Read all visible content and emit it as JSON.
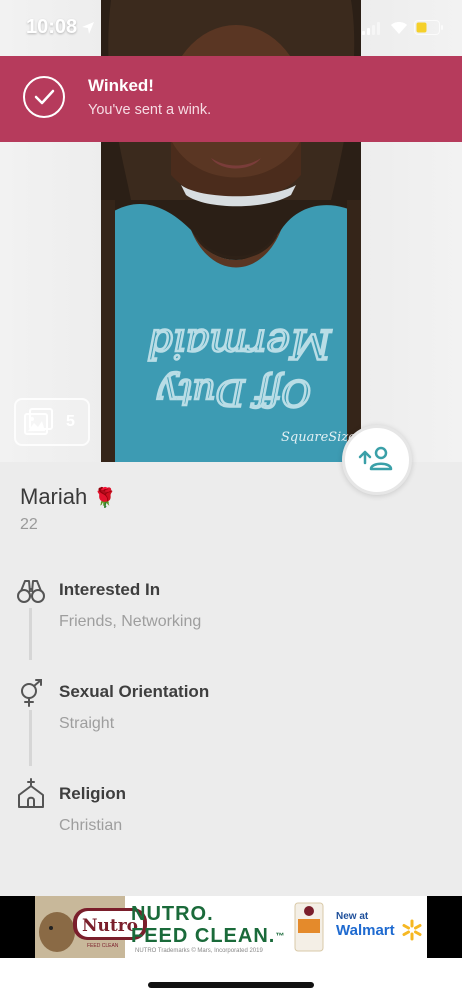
{
  "status_bar": {
    "time": "10:08"
  },
  "toast": {
    "title": "Winked!",
    "subtitle": "You've sent a wink."
  },
  "photo": {
    "count": "5",
    "watermark": "SquareSized"
  },
  "profile": {
    "name": "Mariah",
    "name_emoji": "🌹",
    "age": "22",
    "details": [
      {
        "icon": "binoculars-icon",
        "title": "Interested In",
        "value": "Friends, Networking"
      },
      {
        "icon": "gender-symbol-icon",
        "title": "Sexual Orientation",
        "value": "Straight"
      },
      {
        "icon": "church-icon",
        "title": "Religion",
        "value": "Christian"
      }
    ]
  },
  "ad": {
    "logo": "Nutro",
    "logo_sub": "FEED CLEAN",
    "headline_1": "NUTRO.",
    "headline_2": "FEED CLEAN.",
    "tm": "™",
    "new_at": "New at",
    "retailer": "Walmart",
    "fine_print": "NUTRO Trademarks © Mars, Incorporated 2019"
  },
  "colors": {
    "toast": "#b63b5c",
    "accent_teal": "#3aa0a8",
    "profile_bg": "#ececec"
  }
}
